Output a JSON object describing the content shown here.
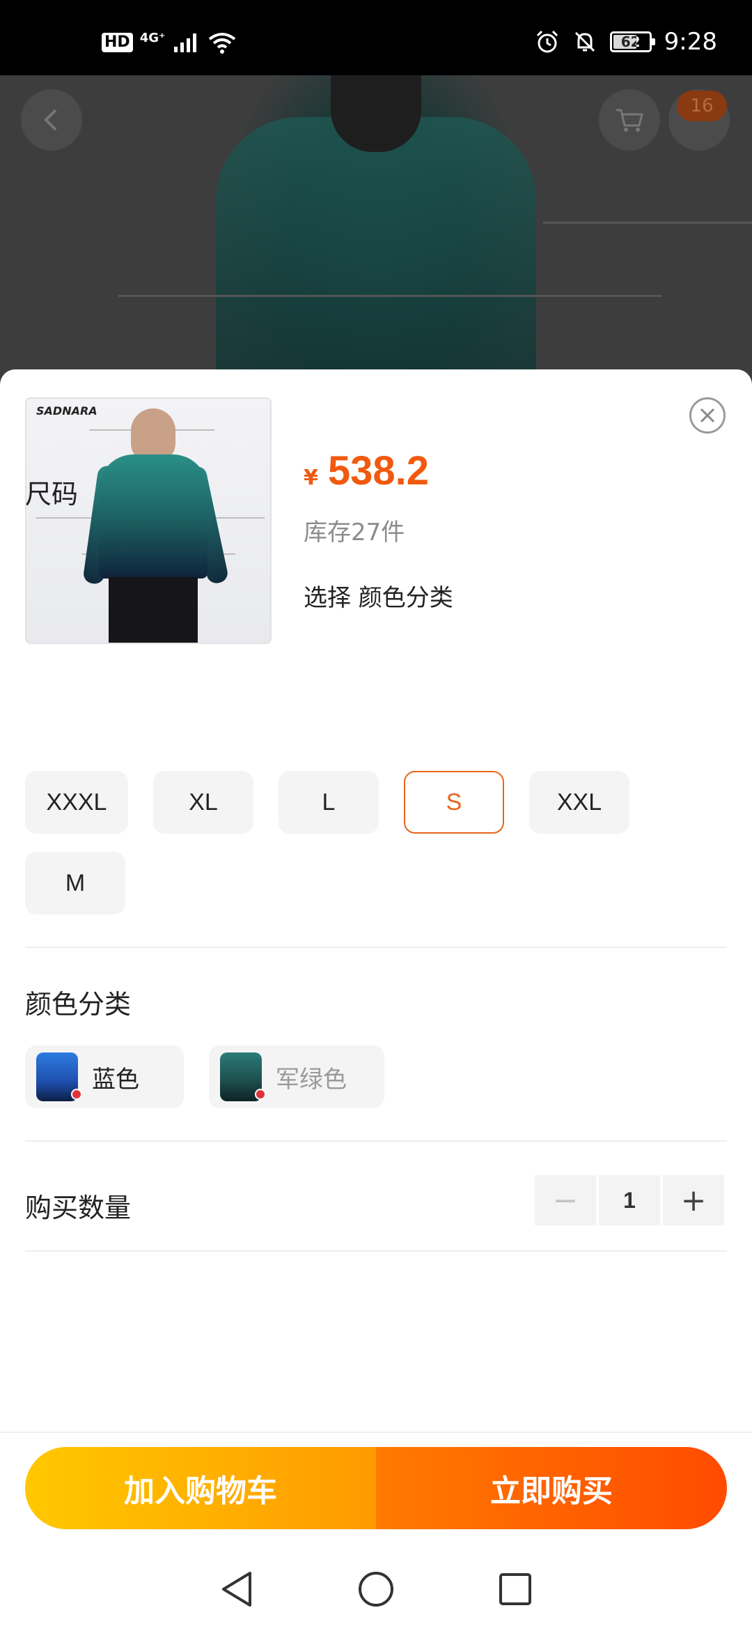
{
  "status_bar": {
    "hd": "HD",
    "network": "4G⁺",
    "battery": "62",
    "time": "9:28"
  },
  "background": {
    "cart_badge": "16"
  },
  "product": {
    "thumb_brand": "SADNARA",
    "currency": "¥",
    "price": "538.2",
    "stock": "库存27件",
    "select_hint": "选择 颜色分类"
  },
  "size_section": {
    "title": "尺码",
    "options": [
      "XXXL",
      "XL",
      "L",
      "S",
      "XXL",
      "M"
    ],
    "selected": "S"
  },
  "color_section": {
    "title": "颜色分类",
    "options": [
      "蓝色",
      "军绿色"
    ]
  },
  "quantity": {
    "title": "购买数量",
    "minus": "−",
    "value": "1",
    "plus": "+"
  },
  "actions": {
    "add_to_cart": "加入购物车",
    "buy_now": "立即购买"
  },
  "colors": {
    "accent": "#f0590f",
    "selected_border": "#e8641b",
    "cart_start": "#ffc800",
    "buy_end": "#ff4b00"
  }
}
